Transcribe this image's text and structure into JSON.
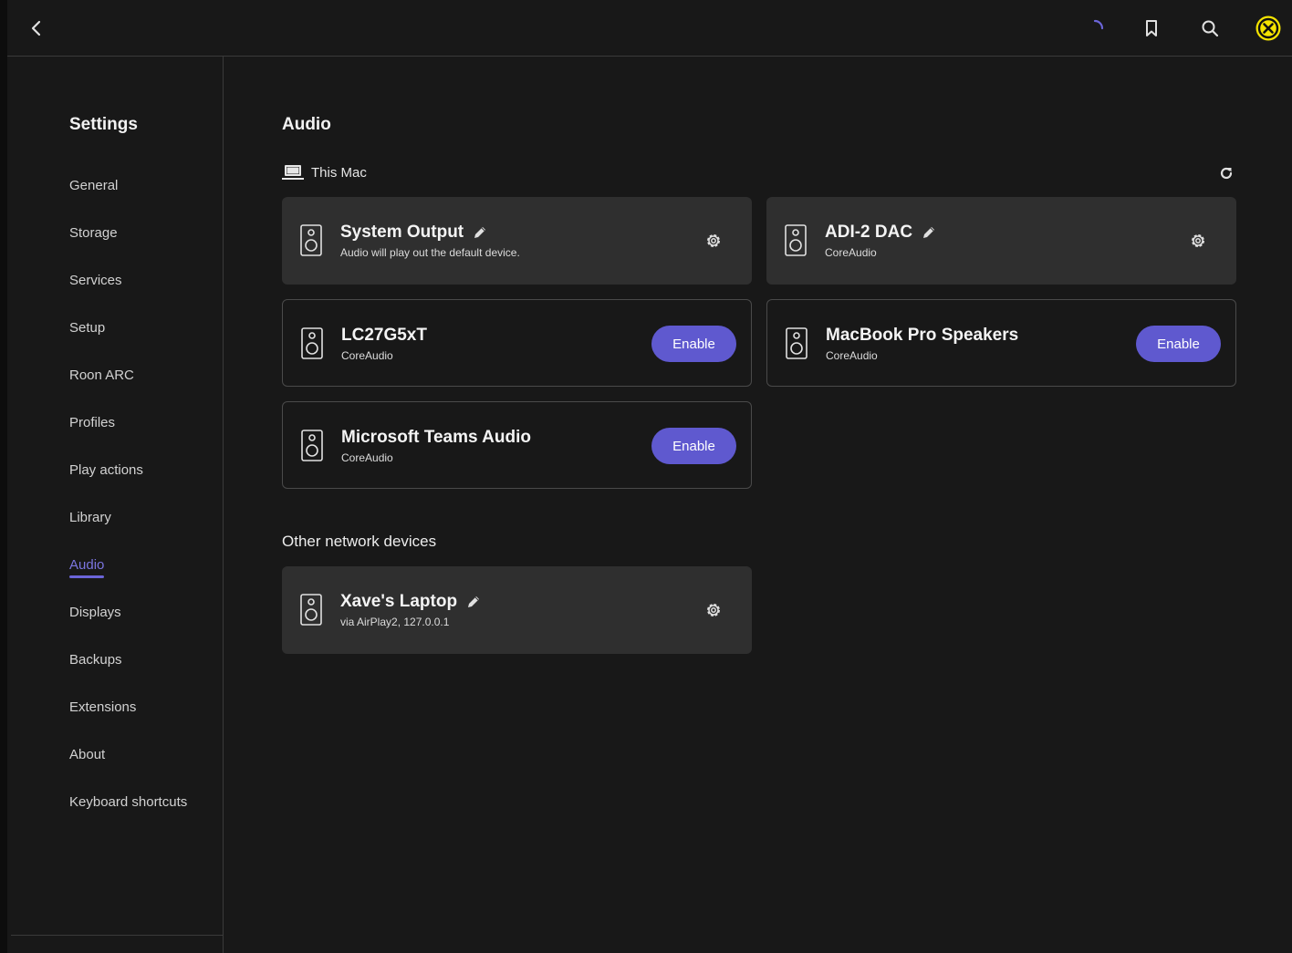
{
  "colors": {
    "background": "#181818",
    "card": "#2f2f2f",
    "accent": "#5f59cf",
    "active_nav": "#7b75e0",
    "profile_badge": "#f4e300"
  },
  "topbar": {
    "icons": [
      "back-icon",
      "loading-spinner-icon",
      "bookmark-icon",
      "search-icon",
      "profile-icon"
    ]
  },
  "sidebar": {
    "title": "Settings",
    "active": "Audio",
    "items": [
      {
        "label": "General"
      },
      {
        "label": "Storage"
      },
      {
        "label": "Services"
      },
      {
        "label": "Setup"
      },
      {
        "label": "Roon ARC"
      },
      {
        "label": "Profiles"
      },
      {
        "label": "Play actions"
      },
      {
        "label": "Library"
      },
      {
        "label": "Audio"
      },
      {
        "label": "Displays"
      },
      {
        "label": "Backups"
      },
      {
        "label": "Extensions"
      },
      {
        "label": "About"
      },
      {
        "label": "Keyboard shortcuts"
      }
    ]
  },
  "main": {
    "title": "Audio",
    "this_mac": {
      "label": "This Mac",
      "devices": [
        {
          "name": "System Output",
          "sub": "Audio will play out the default device.",
          "state": "enabled"
        },
        {
          "name": "ADI-2 DAC",
          "sub": "CoreAudio",
          "state": "enabled"
        },
        {
          "name": "LC27G5xT",
          "sub": "CoreAudio",
          "state": "disabled",
          "button": "Enable"
        },
        {
          "name": "MacBook Pro Speakers",
          "sub": "CoreAudio",
          "state": "disabled",
          "button": "Enable"
        },
        {
          "name": "Microsoft Teams Audio",
          "sub": "CoreAudio",
          "state": "disabled",
          "button": "Enable"
        }
      ]
    },
    "other": {
      "label": "Other network devices",
      "devices": [
        {
          "name": "Xave's Laptop",
          "sub": "via AirPlay2, 127.0.0.1",
          "state": "enabled"
        }
      ]
    }
  }
}
